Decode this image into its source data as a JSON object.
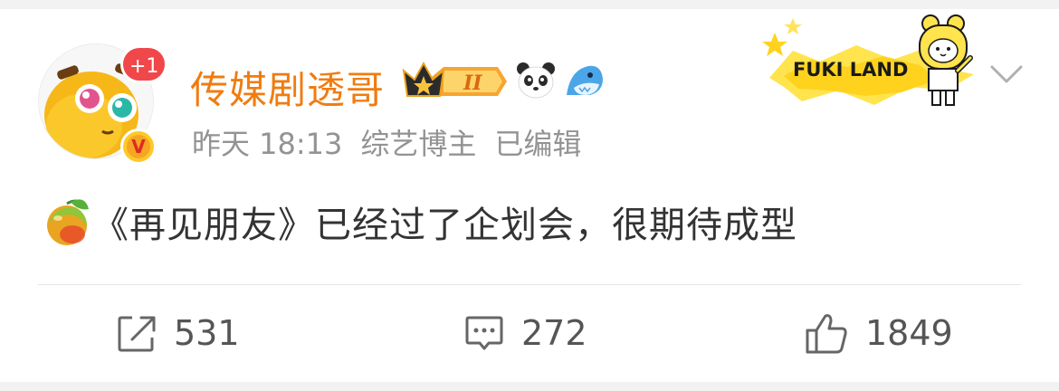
{
  "post": {
    "author": {
      "name": "传媒剧透哥",
      "notification_badge": "+1",
      "verified_mark": "V",
      "badge_icons": [
        "crown-level-badge",
        "panda-icon",
        "shark-icon"
      ],
      "crown_level": "II"
    },
    "meta": {
      "time": "昨天 18:13",
      "role": "综艺博主",
      "edited": "已编辑"
    },
    "sticker_text": "FUKI LAND",
    "emoji_name": "mango-emoji",
    "content": "《再见朋友》已经过了企划会，很期待成型"
  },
  "actions": {
    "repost_count": "531",
    "comment_count": "272",
    "like_count": "1849"
  },
  "colors": {
    "username": "#f07c10",
    "meta": "#939393",
    "content": "#333333",
    "badge_red": "#f0474a",
    "verified_yellow": "#ffc82a"
  }
}
